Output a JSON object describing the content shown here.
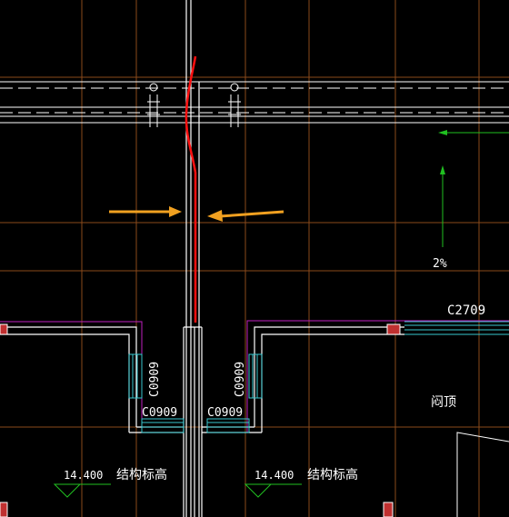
{
  "drawing": {
    "background_color": "#000000",
    "colors": {
      "grid_axis": "#8a4a1a",
      "wall": "#ffffff",
      "window": "#39c8d0",
      "boundary": "#c020c0",
      "markup_red": "#ff1010",
      "arrow_annotation": "#f0a020",
      "slope_arrow": "#20c020",
      "column_fill": "#c03030"
    },
    "window_tags": {
      "c2709": "C2709",
      "c0909_left_vertical": "C0909",
      "c0909_right_vertical": "C0909",
      "c0909_left_horizontal": "C0909",
      "c0909_right_horizontal": "C0909"
    },
    "slope_label": "2%",
    "roof_label": "闷顶",
    "elevation_left": {
      "value": "14.400",
      "label": "结构标高"
    },
    "elevation_right": {
      "value": "14.400",
      "label": "结构标高"
    }
  }
}
